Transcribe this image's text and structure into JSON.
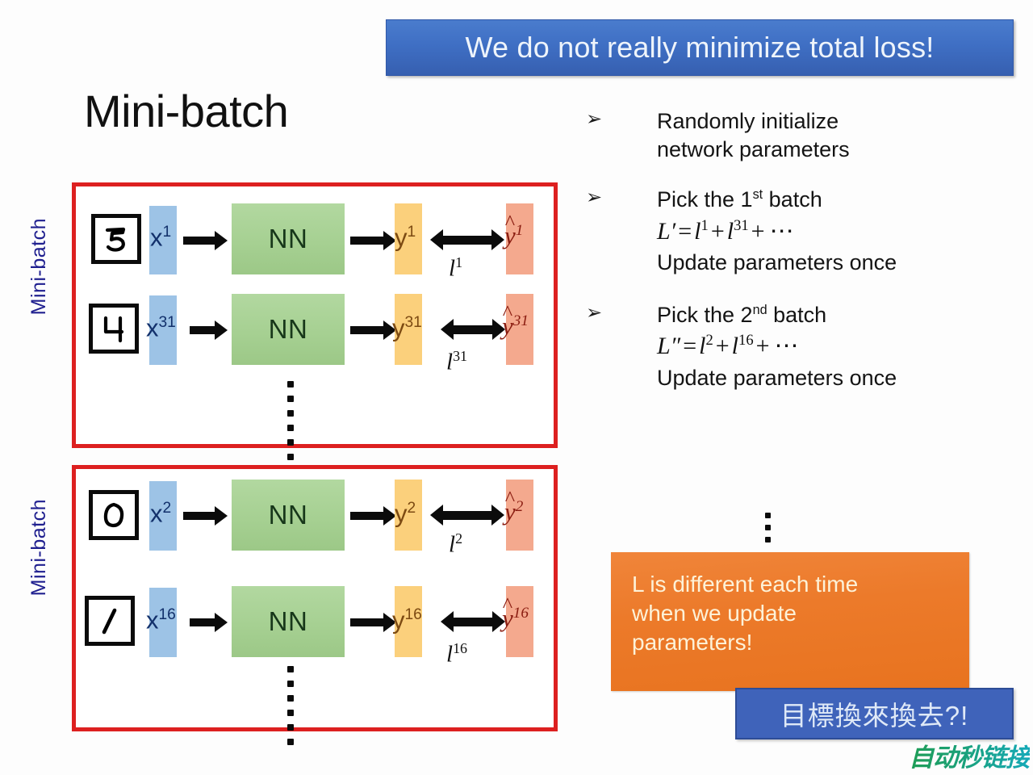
{
  "header": {
    "banner_text": "We do not really minimize total loss!",
    "banner_color": "#3f6fc4"
  },
  "slide": {
    "title": "Mini-batch"
  },
  "diagram": {
    "box_border_color": "#dd2020",
    "side_label": "Mini-batch",
    "nn_label": "NN",
    "batches": [
      {
        "side_label": "Mini-batch",
        "rows": [
          {
            "digit": "5",
            "x_label": "x",
            "x_sup": "1",
            "y_label": "y",
            "y_sup": "1",
            "yhat_label": "y",
            "yhat_sup": "1",
            "loss_label": "l",
            "loss_sup": "1"
          },
          {
            "digit": "4",
            "x_label": "x",
            "x_sup": "31",
            "y_label": "y",
            "y_sup": "31",
            "yhat_label": "y",
            "yhat_sup": "31",
            "loss_label": "l",
            "loss_sup": "31"
          }
        ]
      },
      {
        "side_label": "Mini-batch",
        "rows": [
          {
            "digit": "0",
            "x_label": "x",
            "x_sup": "2",
            "y_label": "y",
            "y_sup": "2",
            "yhat_label": "y",
            "yhat_sup": "2",
            "loss_label": "l",
            "loss_sup": "2"
          },
          {
            "digit": "1",
            "x_label": "x",
            "x_sup": "16",
            "y_label": "y",
            "y_sup": "16",
            "yhat_label": "y",
            "yhat_sup": "16",
            "loss_label": "l",
            "loss_sup": "16"
          }
        ]
      }
    ],
    "colors": {
      "input_bar": "#9dc3e6",
      "nn_box": "#a6d092",
      "output_bar": "#fbd07c",
      "target_bar": "#f4a98e",
      "side_label": "#1f1f8f"
    }
  },
  "bullets": [
    {
      "marker": "➢",
      "lines": [
        "Randomly initialize",
        "network parameters"
      ]
    },
    {
      "marker": "➢",
      "line1_a": "Pick the 1",
      "line1_sup": "st",
      "line1_b": " batch",
      "math_lhs": "L′",
      "math_eq": "=",
      "math_t1": "l",
      "math_t1_sup": "1",
      "math_plus1": "+",
      "math_t2": "l",
      "math_t2_sup": "31",
      "math_plus2": "+",
      "math_tail": "⋯",
      "line3": "Update parameters once"
    },
    {
      "marker": "➢",
      "line1_a": "Pick the 2",
      "line1_sup": "nd",
      "line1_b": " batch",
      "math_lhs": "L″",
      "math_eq": "=",
      "math_t1": "l",
      "math_t1_sup": "2",
      "math_plus1": "+",
      "math_t2": "l",
      "math_t2_sup": "16",
      "math_plus2": "+",
      "math_tail": "⋯",
      "line3": "Update parameters once"
    }
  ],
  "orange_callout": {
    "lines": [
      "L is different each time",
      "when we update",
      "parameters!"
    ],
    "bg_color": "#ec7a2a",
    "text_color": "#fdf2d8"
  },
  "cn_box": {
    "text": "目標換來換去?!",
    "bg_color": "#3f63ba",
    "text_color": "#dfe9f7"
  },
  "watermark": {
    "text": "自动秒链接"
  }
}
